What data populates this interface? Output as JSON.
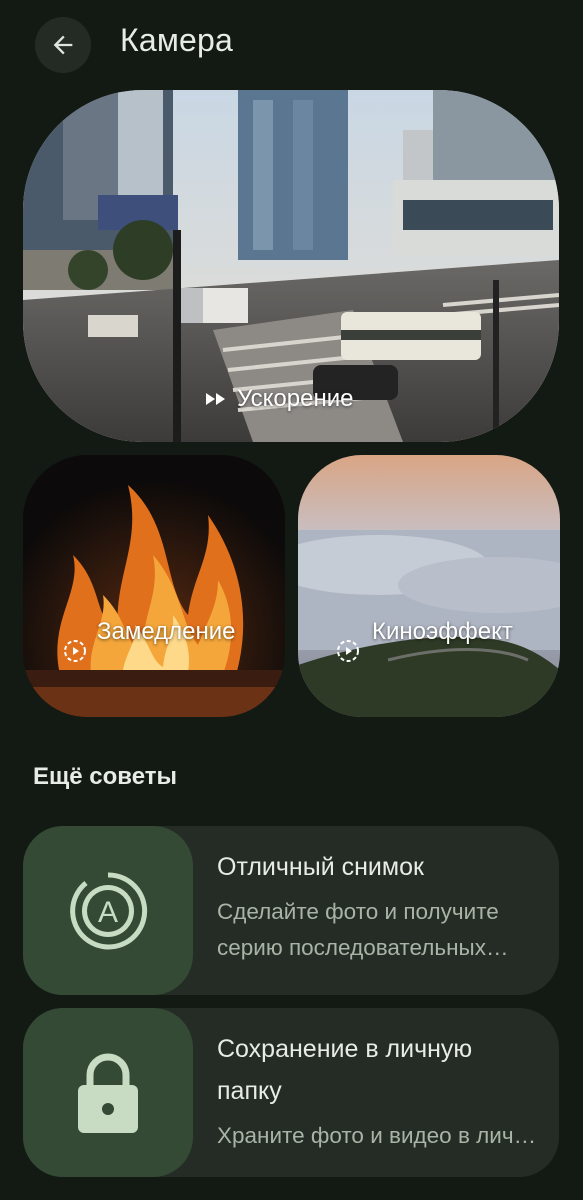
{
  "header": {
    "title": "Камера"
  },
  "feature_cards": {
    "fast": {
      "label": "Ускорение",
      "icon": "fast-forward-icon"
    },
    "slow": {
      "label": "Замедление",
      "icon": "play-circle-dashed-icon"
    },
    "cine": {
      "label": "Киноэффект",
      "icon": "play-circle-dashed-icon"
    }
  },
  "more_tips": {
    "title": "Ещё советы",
    "items": [
      {
        "title": "Отличный снимок",
        "description": "Сделайте фото и получите серию последовательных снимков",
        "icon": "top-shot-icon"
      },
      {
        "title": "Сохранение в личную папку",
        "description": "Храните фото и видео в личной папке",
        "icon": "lock-icon"
      }
    ]
  },
  "colors": {
    "background": "#131a14",
    "tip_card": "#242c25",
    "tip_thumb": "#344a35",
    "icon_tint": "#c8dcc4"
  }
}
